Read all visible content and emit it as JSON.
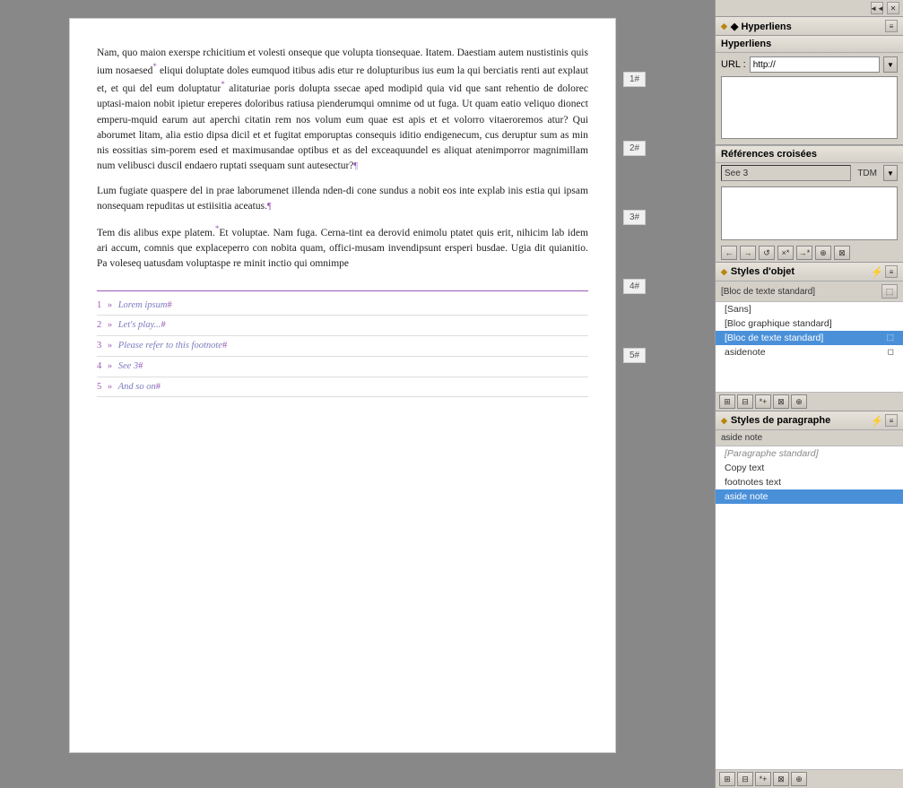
{
  "document": {
    "paragraphs": [
      "Nam, quo maion exerspe rchicitium et volesti onseque que volupta tionsequae. Itatem. Daestiam autem nustistinis quis ium nosaesed",
      " eliqui doluptate doles eumquod itibus adis etur re dolupturibus ius eum la qui berciatis renti aut explaut et, et qui del eum doluptatur",
      " alitaturiae poris dolupta ssecae aped modipid quia vid que sant rehentio de dolorec uptasi-maion nobit ipietur ereperes doloribus ratiusa pienderumqui omnime od ut fuga. Ut quam eatio veliquo dionect emperu-mquid earum aut aperchi citatin rem nos volum eum quae est apis et et volorro vitaeroremos atur? Qui aborumet litam, alia estio dipsa dicil et et fugitat emporuptas consequis iditio endigenecum, cus deruptur sum as min nis eossitias sim-porem esed et maximusandae optibus et as del exceaquundel es aliquat atenimporror magnimillam num velibusci duscil endaero ruptati ssequam sunt autesectur?",
      "Lum fugiate quaspere del in prae laborumenet illenda nden-di cone sundus a nobit eos inte explab inis estia qui ipsam nonsequam repuditas ut estiisitia aceatus.",
      "Tem dis alibus expe platem.",
      "Et voluptae. Nam fuga. Cerna-tint ea derovid enimolu ptatet quis erit, nihicim lab idem ari accum, comnis que explaceperro con nobita quam, offici-musam invendipsunt ersperi busdae. Ugia dit quianitio. Pa voleseq uatusdam voluptaspe re minit inctio qui omnimpe"
    ],
    "footnotes": [
      {
        "num": "1",
        "arrow": "»",
        "text": "Lorem ipsum",
        "hash": "#"
      },
      {
        "num": "2",
        "arrow": "»",
        "text": "Let's play...",
        "hash": "#"
      },
      {
        "num": "3",
        "arrow": "»",
        "text": "Please refer to this footnote",
        "hash": "#"
      },
      {
        "num": "4",
        "arrow": "»",
        "text": "See 3",
        "hash": "#"
      },
      {
        "num": "5",
        "arrow": "»",
        "text": "And so on",
        "hash": "#"
      }
    ],
    "line_numbers": [
      "1#",
      "2#",
      "3#",
      "4#",
      "5#"
    ]
  },
  "right_panel": {
    "top_controls": {
      "collapse_label": "◄◄"
    },
    "hyperlinks": {
      "panel_title": "◆ Hyperliens",
      "section_title": "Hyperliens",
      "url_label": "URL :",
      "url_value": "http://",
      "controls": [
        "▼",
        "≡"
      ]
    },
    "cross_references": {
      "section_title": "Références croisées",
      "see_value": "See 3",
      "tdm_label": "TDM",
      "toolbar_buttons": [
        "←",
        "→",
        "↺",
        "*×",
        "→*",
        "⊞",
        "⊠"
      ]
    },
    "object_styles": {
      "panel_title": "◆ Styles d'objet",
      "breadcrumb": "[Bloc de texte standard]",
      "items": [
        {
          "label": "[Sans]",
          "selected": false,
          "italic": false
        },
        {
          "label": "[Bloc graphique standard]",
          "selected": false,
          "italic": false
        },
        {
          "label": "[Bloc de texte standard]",
          "selected": true,
          "italic": false
        },
        {
          "label": "asidenote",
          "selected": false,
          "italic": false
        }
      ],
      "toolbar_buttons": [
        "⊞",
        "⊟",
        "*+",
        "⊠",
        "⊕"
      ]
    },
    "para_styles": {
      "panel_title": "◆ Styles de paragraphe",
      "breadcrumb": "aside note",
      "items": [
        {
          "label": "[Paragraphe standard]",
          "selected": false,
          "italic": true
        },
        {
          "label": "Copy text",
          "selected": false,
          "italic": false
        },
        {
          "label": "footnotes text",
          "selected": false,
          "italic": false
        },
        {
          "label": "aside note",
          "selected": true,
          "italic": false
        }
      ],
      "toolbar_buttons": [
        "⊞",
        "⊟",
        "*+",
        "⊠",
        "⊕"
      ]
    }
  }
}
